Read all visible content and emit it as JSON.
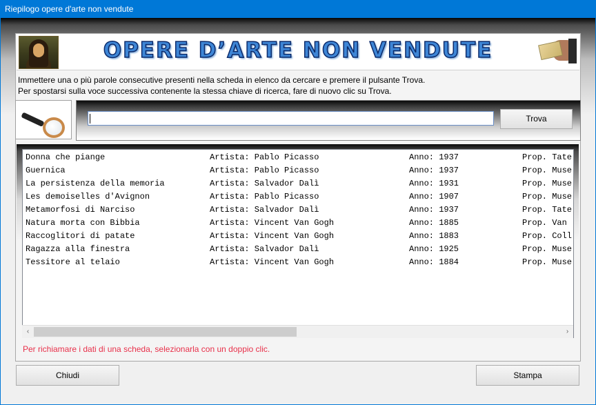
{
  "window": {
    "title": "Riepilogo opere d'arte non vendute"
  },
  "banner": {
    "title": "OPERE D’ARTE NON VENDUTE"
  },
  "instructions": {
    "line1": "Immettere una o più parole consecutive presenti nella scheda in elenco da cercare e premere il pulsante Trova.",
    "line2": "Per spostarsi sulla voce successiva contenente la stessa chiave di ricerca, fare di nuovo clic su Trova."
  },
  "search": {
    "value": "",
    "button": "Trova"
  },
  "list": {
    "rows": [
      {
        "title": "Donna che piange",
        "artist": "Artista: Pablo Picasso",
        "year": "Anno: 1937",
        "owner": "Prop. Tate"
      },
      {
        "title": "Guernica",
        "artist": "Artista: Pablo Picasso",
        "year": "Anno: 1937",
        "owner": "Prop. Muse"
      },
      {
        "title": "La persistenza della memoria",
        "artist": "Artista: Salvador Dalì",
        "year": "Anno: 1931",
        "owner": "Prop. Muse"
      },
      {
        "title": "Les demoiselles d'Avignon",
        "artist": "Artista: Pablo Picasso",
        "year": "Anno: 1907",
        "owner": "Prop. Muse"
      },
      {
        "title": "Metamorfosi di Narciso",
        "artist": "Artista: Salvador Dalì",
        "year": "Anno: 1937",
        "owner": "Prop. Tate"
      },
      {
        "title": "Natura morta con Bibbia",
        "artist": "Artista: Vincent Van Gogh",
        "year": "Anno: 1885",
        "owner": "Prop. Van "
      },
      {
        "title": "Raccoglitori di patate",
        "artist": "Artista: Vincent Van Gogh",
        "year": "Anno: 1883",
        "owner": "Prop. Coll"
      },
      {
        "title": "Ragazza alla finestra",
        "artist": "Artista: Salvador Dalì",
        "year": "Anno: 1925",
        "owner": "Prop. Muse"
      },
      {
        "title": "Tessitore al telaio",
        "artist": "Artista: Vincent Van Gogh",
        "year": "Anno: 1884",
        "owner": "Prop. Muse"
      }
    ],
    "scroll_left": "‹",
    "scroll_right": "›"
  },
  "hint": "Per richiamare i dati di una scheda, selezionarla con un doppio clic.",
  "buttons": {
    "close": "Chiudi",
    "print": "Stampa"
  }
}
